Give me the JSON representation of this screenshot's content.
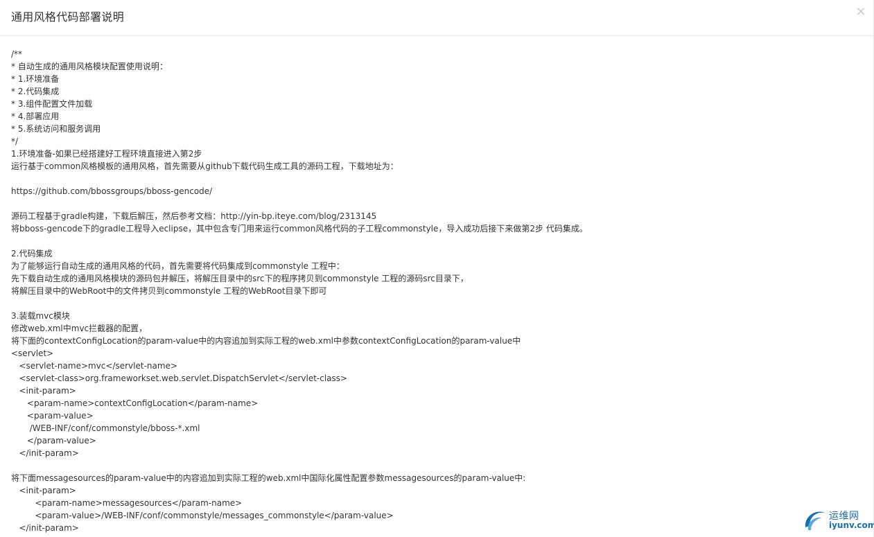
{
  "dialog": {
    "title": "通用风格代码部署说明",
    "close_label": "×"
  },
  "content": {
    "lines": [
      "/**",
      "* 自动生成的通用风格模块配置使用说明：",
      "* 1.环境准备",
      "* 2.代码集成",
      "* 3.组件配置文件加载",
      "* 4.部署应用",
      "* 5.系统访问和服务调用",
      "*/",
      "1.环境准备-如果已经搭建好工程环境直接进入第2步",
      "运行基于common风格模板的通用风格，首先需要从github下载代码生成工具的源码工程，下载地址为：",
      "",
      "https://github.com/bbossgroups/bboss-gencode/",
      "",
      "源码工程基于gradle构建，下载后解压，然后参考文档：http://yin-bp.iteye.com/blog/2313145",
      "将bboss-gencode下的gradle工程导入eclipse，其中包含专门用来运行common风格代码的子工程commonstyle，导入成功后接下来做第2步 代码集成。",
      "",
      "2.代码集成",
      "为了能够运行自动生成的通用风格的代码，首先需要将代码集成到commonstyle 工程中：",
      "先下载自动生成的通用风格模块的源码包并解压，将解压目录中的src下的程序拷贝到commonstyle 工程的源码src目录下，",
      "将解压目录中的WebRoot中的文件拷贝到commonstyle 工程的WebRoot目录下即可",
      "",
      "3.装载mvc模块",
      "修改web.xml中mvc拦截器的配置，",
      "将下面的contextConfigLocation的param-value中的内容追加到实际工程的web.xml中参数contextConfigLocation的param-value中",
      "<servlet>",
      "   <servlet-name>mvc</servlet-name>",
      "   <servlet-class>org.frameworkset.web.servlet.DispatchServlet</servlet-class>",
      "   <init-param>",
      "      <param-name>contextConfigLocation</param-name>",
      "      <param-value>",
      "       /WEB-INF/conf/commonstyle/bboss-*.xml",
      "      </param-value>",
      "   </init-param>",
      "",
      "将下面messagesources的param-value中的内容追加到实际工程的web.xml中国际化属性配置参数messagesources的param-value中:",
      "   <init-param>",
      "         <param-name>messagesources</param-name>",
      "         <param-value>/WEB-INF/conf/commonstyle/messages_commonstyle</param-value>",
      "   </init-param>"
    ]
  },
  "watermark": {
    "logo_icon": "iyunv-swoosh-logo",
    "cn_text": "运维网",
    "en_text": "iyunv.com",
    "color": "#1a6fb0"
  }
}
